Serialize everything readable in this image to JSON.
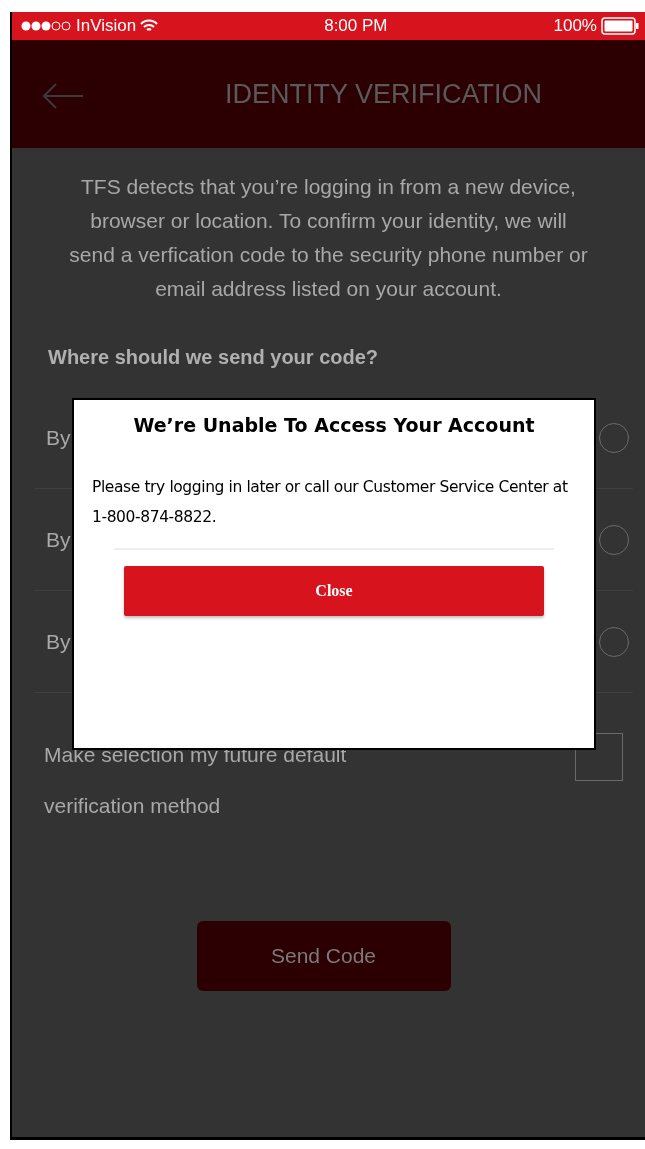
{
  "status_bar": {
    "carrier": "InVision",
    "time": "8:00 PM",
    "battery": "100%"
  },
  "header": {
    "title": "IDENTITY VERIFICATION"
  },
  "intro": "TFS detects that you’re logging in from a new device, browser or location. To confirm your identity, we will send a verfication code to the security phone number or email address listed on your account.",
  "question": "Where should we send your code?",
  "options": [
    {
      "label": "By",
      "selected": false
    },
    {
      "label": "By",
      "selected": false
    },
    {
      "label": "By",
      "selected": false
    }
  ],
  "default_option": {
    "label": "Make selection my future default verification method",
    "checked": false
  },
  "send_button": "Send Code",
  "dialog": {
    "title": "We’re Unable To Access  Your Account",
    "message": "Please try logging in later or call our Customer Service Center at 1-800-874-8822.",
    "close_button": "Close"
  }
}
